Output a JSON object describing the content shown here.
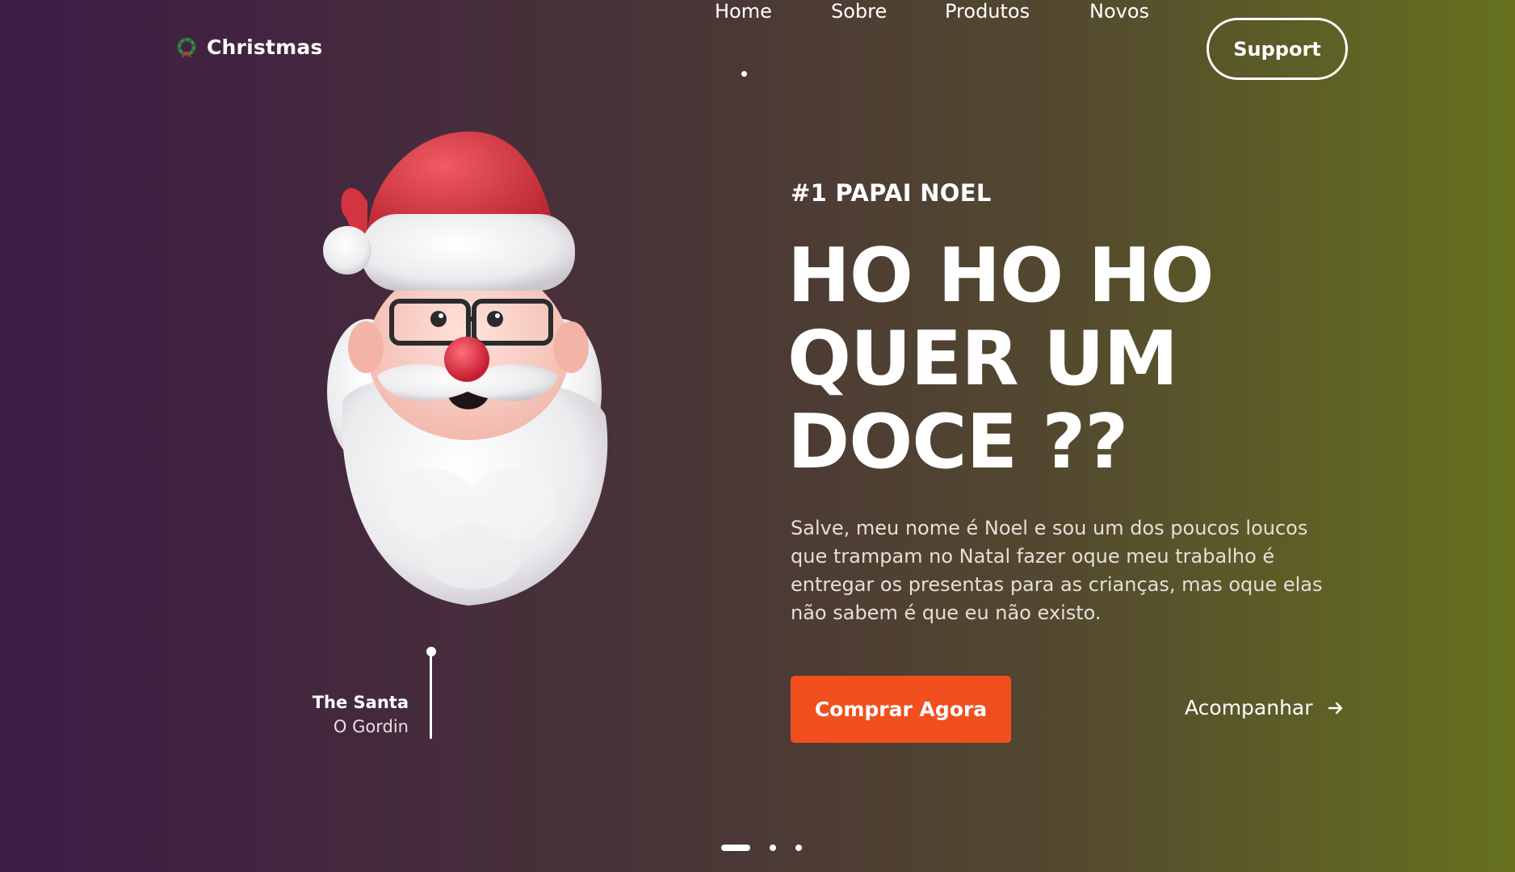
{
  "brand": {
    "name": "Christmas",
    "icon": "wreath-icon"
  },
  "nav": {
    "items": [
      {
        "label": "Home",
        "active": true
      },
      {
        "label": "Sobre"
      },
      {
        "label": "Produtos"
      },
      {
        "label": "Novos"
      }
    ],
    "support_label": "Support"
  },
  "hero": {
    "eyebrow": "#1 PAPAI NOEL",
    "headline": [
      "HO HO HO",
      "QUER UM",
      "DOCE ??"
    ],
    "description": "Salve, meu nome é Noel e sou um dos poucos loucos que trampam no Natal fazer oque meu trabalho é entregar os presentas para as crianças, mas oque elas não sabem é que eu não existo.",
    "buy_label": "Comprar Agora",
    "follow_label": "Acompanhar",
    "follow_icon": "arrow-right-icon"
  },
  "santa": {
    "image": "santa-head-3d",
    "caption_title": "The Santa",
    "caption_sub": "O Gordin"
  },
  "pager": {
    "count": 3,
    "active_index": 0
  },
  "colors": {
    "accent": "#f1501e",
    "bg_left": "#3d1b45",
    "bg_right": "#66711f"
  }
}
